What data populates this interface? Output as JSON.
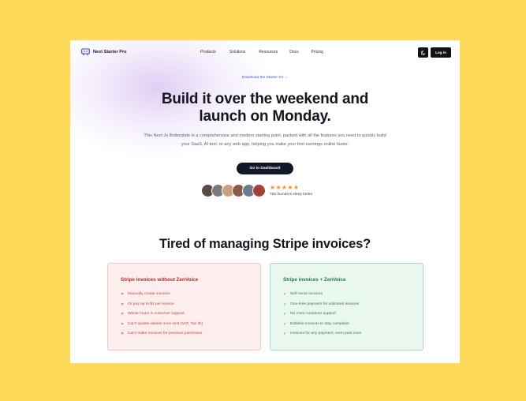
{
  "nav": {
    "brand": "Next Starter Pro",
    "items": [
      "Products",
      "Solutions",
      "Resources",
      "Docs",
      "Pricing"
    ],
    "theme_icon": "moon-icon",
    "login_label": "Log in"
  },
  "hero": {
    "announce": "Download the Starter Kit",
    "announce_arrow": "→",
    "headline_line1": "Build it over the weekend and",
    "headline_line2": "launch on Monday.",
    "subtitle": "This Next Js Boilerplate is a comprehensive and modern starting point, packed with all the features you need to quickly build your SaaS, AI tool, or any web app, helping you make your first earnings online faster.",
    "cta_label": "Go to Dashboard",
    "stars": "★★★★★",
    "social_proof": "785 founders sleep better"
  },
  "avatar_colors": [
    "#5b4a44",
    "#7a7a80",
    "#c9a27a",
    "#8c5a4a",
    "#6e7b8c",
    "#a3403c"
  ],
  "comparison": {
    "title": "Tired of managing Stripe invoices?",
    "without": {
      "heading": "Stripe invoices without ZenVoice",
      "mark": "✕",
      "items": [
        "Manually create invoices",
        "Or pay up to $2 per invoice",
        "Waste hours in customer support",
        "Can't update details once sent (VAT, Tax ID)",
        "Can't make invoices for previous purchases"
      ]
    },
    "with": {
      "heading": "Stripe invoices + ZenVoice",
      "mark": "✓",
      "items": [
        "Self-serve invoices",
        "One-time payment for unlimited invoices",
        "No more customer support",
        "Editable invoices to stay compliant",
        "Invoices for any payment, even past ones"
      ]
    }
  },
  "colors": {
    "background": "#ffd95a",
    "primary_dark": "#111318",
    "bad_accent": "#b32828",
    "good_accent": "#1f7a45"
  }
}
